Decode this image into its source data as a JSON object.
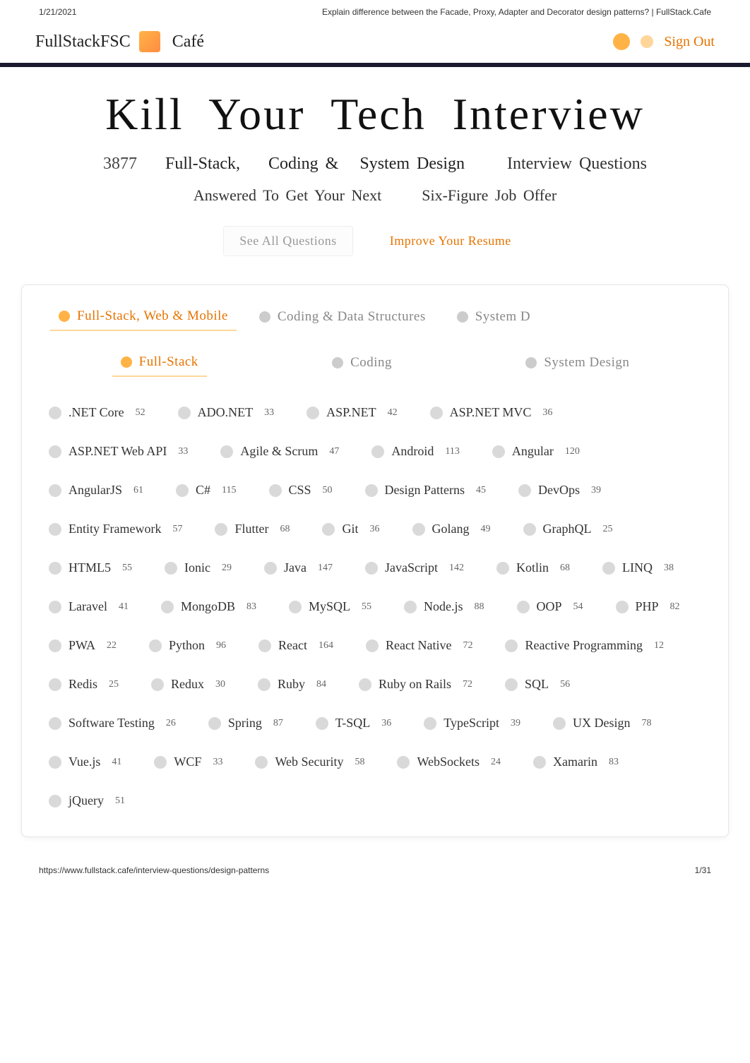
{
  "page_header": {
    "date": "1/21/2021",
    "title": "Explain difference between the Facade, Proxy, Adapter and Decorator design patterns? | FullStack.Cafe"
  },
  "navbar": {
    "brand_main": "FullStackFSC",
    "brand_sub": "Café",
    "signout": "Sign Out"
  },
  "hero": {
    "title": "Kill Your  Tech  Interview",
    "count": "3877",
    "sub1_a": "Full-Stack,",
    "sub1_b": "Coding &",
    "sub1_c": "System Design",
    "sub1_d": "Interview Questions",
    "sub2_a": "Answered To Get Your Next",
    "sub2_b": "Six-Figure Job Offer",
    "btn_all": "See All Questions",
    "btn_resume": "Improve Your Resume"
  },
  "tabs_top": [
    {
      "label": "Full-Stack, Web & Mobile",
      "active": true
    },
    {
      "label": "Coding & Data Structures",
      "active": false
    },
    {
      "label": "System D",
      "active": false
    }
  ],
  "tabs_sub": [
    {
      "label": "Full-Stack",
      "active": true
    },
    {
      "label": "Coding",
      "active": false
    },
    {
      "label": "System Design",
      "active": false
    }
  ],
  "topics": [
    {
      "name": ".NET Core",
      "count": "52"
    },
    {
      "name": "ADO.NET",
      "count": "33"
    },
    {
      "name": "ASP.NET",
      "count": "42"
    },
    {
      "name": "ASP.NET MVC",
      "count": "36"
    },
    {
      "name": "ASP.NET Web API",
      "count": "33"
    },
    {
      "name": "Agile & Scrum",
      "count": "47"
    },
    {
      "name": "Android",
      "count": "113"
    },
    {
      "name": "Angular",
      "count": "120"
    },
    {
      "name": "AngularJS",
      "count": "61"
    },
    {
      "name": "C#",
      "count": "115"
    },
    {
      "name": "CSS",
      "count": "50"
    },
    {
      "name": "Design Patterns",
      "count": "45"
    },
    {
      "name": "DevOps",
      "count": "39"
    },
    {
      "name": "Entity Framework",
      "count": "57"
    },
    {
      "name": "Flutter",
      "count": "68"
    },
    {
      "name": "Git",
      "count": "36"
    },
    {
      "name": "Golang",
      "count": "49"
    },
    {
      "name": "GraphQL",
      "count": "25"
    },
    {
      "name": "HTML5",
      "count": "55"
    },
    {
      "name": "Ionic",
      "count": "29"
    },
    {
      "name": "Java",
      "count": "147"
    },
    {
      "name": "JavaScript",
      "count": "142"
    },
    {
      "name": "Kotlin",
      "count": "68"
    },
    {
      "name": "LINQ",
      "count": "38"
    },
    {
      "name": "Laravel",
      "count": "41"
    },
    {
      "name": "MongoDB",
      "count": "83"
    },
    {
      "name": "MySQL",
      "count": "55"
    },
    {
      "name": "Node.js",
      "count": "88"
    },
    {
      "name": "OOP",
      "count": "54"
    },
    {
      "name": "PHP",
      "count": "82"
    },
    {
      "name": "PWA",
      "count": "22"
    },
    {
      "name": "Python",
      "count": "96"
    },
    {
      "name": "React",
      "count": "164"
    },
    {
      "name": "React Native",
      "count": "72"
    },
    {
      "name": "Reactive Programming",
      "count": "12"
    },
    {
      "name": "Redis",
      "count": "25"
    },
    {
      "name": "Redux",
      "count": "30"
    },
    {
      "name": "Ruby",
      "count": "84"
    },
    {
      "name": "Ruby on Rails",
      "count": "72"
    },
    {
      "name": "SQL",
      "count": "56"
    },
    {
      "name": "Software Testing",
      "count": "26"
    },
    {
      "name": "Spring",
      "count": "87"
    },
    {
      "name": "T-SQL",
      "count": "36"
    },
    {
      "name": "TypeScript",
      "count": "39"
    },
    {
      "name": "UX Design",
      "count": "78"
    },
    {
      "name": "Vue.js",
      "count": "41"
    },
    {
      "name": "WCF",
      "count": "33"
    },
    {
      "name": "Web Security",
      "count": "58"
    },
    {
      "name": "WebSockets",
      "count": "24"
    },
    {
      "name": "Xamarin",
      "count": "83"
    },
    {
      "name": "jQuery",
      "count": "51"
    }
  ],
  "page_footer": {
    "url": "https://www.fullstack.cafe/interview-questions/design-patterns",
    "page": "1/31"
  }
}
